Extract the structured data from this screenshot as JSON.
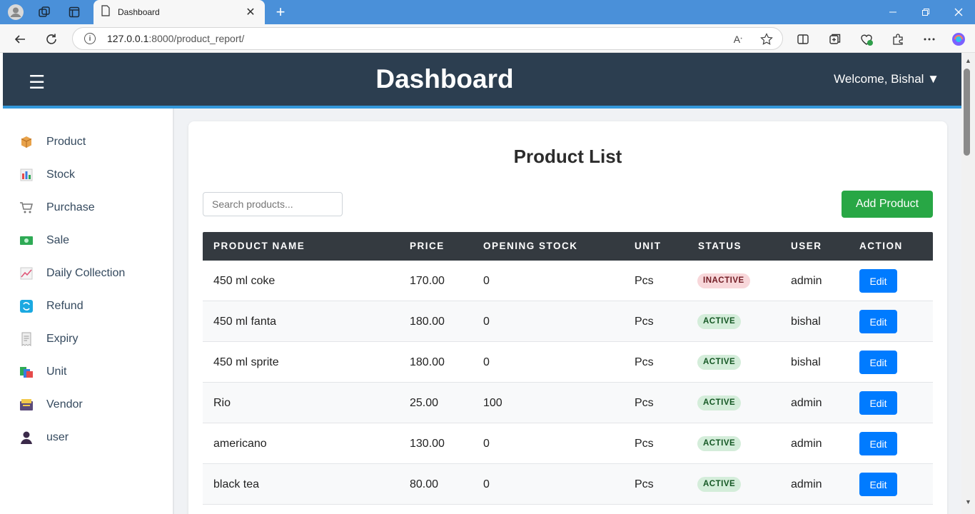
{
  "browser": {
    "tab_title": "Dashboard",
    "url_host": "127.0.0.1",
    "url_path": ":8000/product_report/",
    "close_glyph": "✕",
    "newtab_glyph": "+"
  },
  "header": {
    "menu_glyph": "☰",
    "title": "Dashboard",
    "welcome": "Welcome, Bishal ▼"
  },
  "sidebar": {
    "items": [
      {
        "label": "Product",
        "icon": "package-icon"
      },
      {
        "label": "Stock",
        "icon": "bar-chart-icon"
      },
      {
        "label": "Purchase",
        "icon": "shopping-cart-icon"
      },
      {
        "label": "Sale",
        "icon": "money-icon"
      },
      {
        "label": "Daily Collection",
        "icon": "trend-chart-icon"
      },
      {
        "label": "Refund",
        "icon": "refresh-icon"
      },
      {
        "label": "Expiry",
        "icon": "receipt-icon"
      },
      {
        "label": "Unit",
        "icon": "books-icon"
      },
      {
        "label": "Vendor",
        "icon": "card-box-icon"
      },
      {
        "label": "user",
        "icon": "user-icon"
      }
    ]
  },
  "main": {
    "title": "Product List",
    "search_placeholder": "Search products...",
    "add_button": "Add Product",
    "columns": [
      "PRODUCT NAME",
      "PRICE",
      "OPENING STOCK",
      "UNIT",
      "STATUS",
      "USER",
      "ACTION"
    ],
    "rows": [
      {
        "name": "450 ml coke",
        "price": "170.00",
        "stock": "0",
        "unit": "Pcs",
        "status": "INACTIVE",
        "user": "admin",
        "action": "Edit"
      },
      {
        "name": "450 ml fanta",
        "price": "180.00",
        "stock": "0",
        "unit": "Pcs",
        "status": "ACTIVE",
        "user": "bishal",
        "action": "Edit"
      },
      {
        "name": "450 ml sprite",
        "price": "180.00",
        "stock": "0",
        "unit": "Pcs",
        "status": "ACTIVE",
        "user": "bishal",
        "action": "Edit"
      },
      {
        "name": "Rio",
        "price": "25.00",
        "stock": "100",
        "unit": "Pcs",
        "status": "ACTIVE",
        "user": "admin",
        "action": "Edit"
      },
      {
        "name": "americano",
        "price": "130.00",
        "stock": "0",
        "unit": "Pcs",
        "status": "ACTIVE",
        "user": "admin",
        "action": "Edit"
      },
      {
        "name": "black tea",
        "price": "80.00",
        "stock": "0",
        "unit": "Pcs",
        "status": "ACTIVE",
        "user": "admin",
        "action": "Edit"
      }
    ]
  },
  "colors": {
    "header_bg": "#2c3e50",
    "header_accent": "#3498db",
    "add_button": "#28a745",
    "edit_button": "#007bff",
    "active_badge": "#d4edda",
    "inactive_badge": "#f8d7da"
  }
}
